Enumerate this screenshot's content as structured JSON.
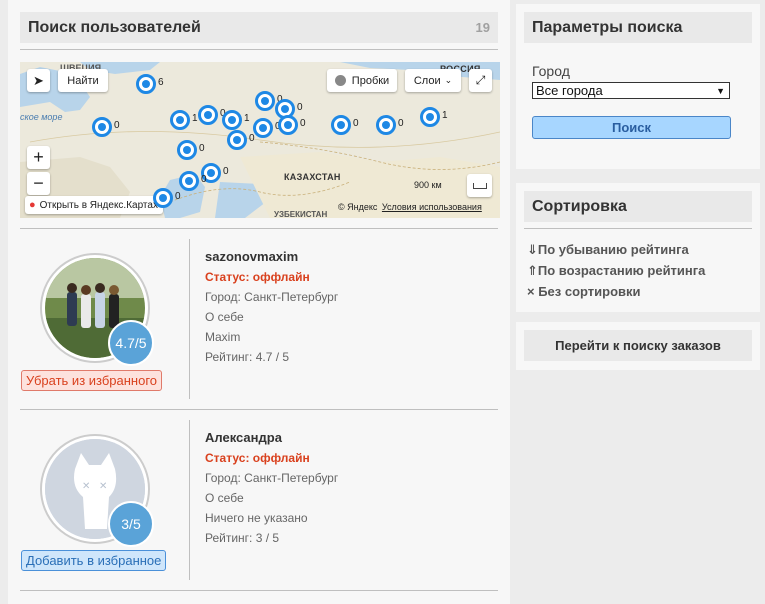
{
  "main": {
    "title": "Поиск пользователей",
    "count": "19"
  },
  "map": {
    "find_label": "Найти",
    "traffic_label": "Пробки",
    "layers_label": "Слои",
    "open_label": "Открыть в Яндекс.Картах",
    "copyright": "© Яндекс",
    "terms_label": "Условия использования",
    "scale_label": "900 км",
    "labels": {
      "russia": "РОССИЯ",
      "kazakhstan": "КАЗАХСТАН",
      "uzbekistan": "УЗБЕКИСТАН",
      "sweden": "ШВЕЦИЯ",
      "sea": "ское море"
    },
    "pins": [
      "6",
      "1",
      "0",
      "1",
      "0",
      "0",
      "0",
      "0",
      "0",
      "0",
      "1",
      "0",
      "0",
      "0",
      "0",
      "0",
      "0"
    ]
  },
  "users": [
    {
      "username": "sazonovmaxim",
      "status": "Статус: оффлайн",
      "city": "Город: Санкт-Петербург",
      "about_label": "О себе",
      "about": "Maxim",
      "rating_text": "Рейтинг: 4.7 / 5",
      "badge": "4.7/5",
      "fav_button": "Убрать из избранного"
    },
    {
      "username": "Александра",
      "status": "Статус: оффлайн",
      "city": "Город: Санкт-Петербург",
      "about_label": "О себе",
      "about": "Ничего не указано",
      "rating_text": "Рейтинг: 3 / 5",
      "badge": "3/5",
      "fav_button": "Добавить в избранное"
    }
  ],
  "search_params": {
    "title": "Параметры поиска",
    "city_label": "Город",
    "city_value": "Все города",
    "search_button": "Поиск"
  },
  "sorting": {
    "title": "Сортировка",
    "items": [
      "⇓По убыванию рейтинга",
      "⇑По возрастанию рейтинга",
      "× Без сортировки"
    ]
  },
  "orders_button": "Перейти к поиску заказов"
}
